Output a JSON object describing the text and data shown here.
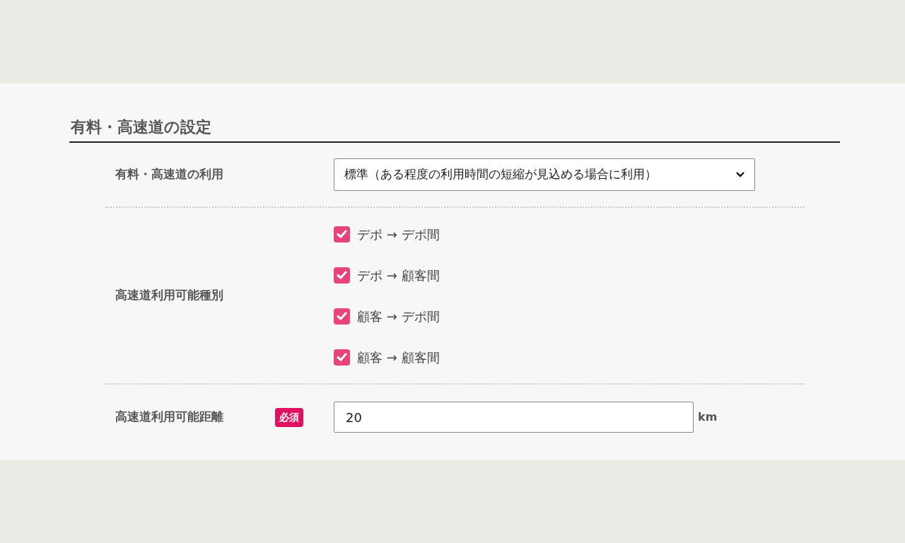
{
  "section": {
    "title": "有料・高速道の設定"
  },
  "usage": {
    "label": "有料・高速道の利用",
    "value": "標準（ある程度の利用時間の短縮が見込める場合に利用）"
  },
  "types": {
    "label": "高速道利用可能種別",
    "options": [
      {
        "label": "デポ → デポ間",
        "checked": true
      },
      {
        "label": "デポ → 顧客間",
        "checked": true
      },
      {
        "label": "顧客 → デポ間",
        "checked": true
      },
      {
        "label": "顧客 → 顧客間",
        "checked": true
      }
    ]
  },
  "distance": {
    "label": "高速道利用可能距離",
    "required_badge": "必須",
    "value": "20",
    "unit": "km"
  }
}
